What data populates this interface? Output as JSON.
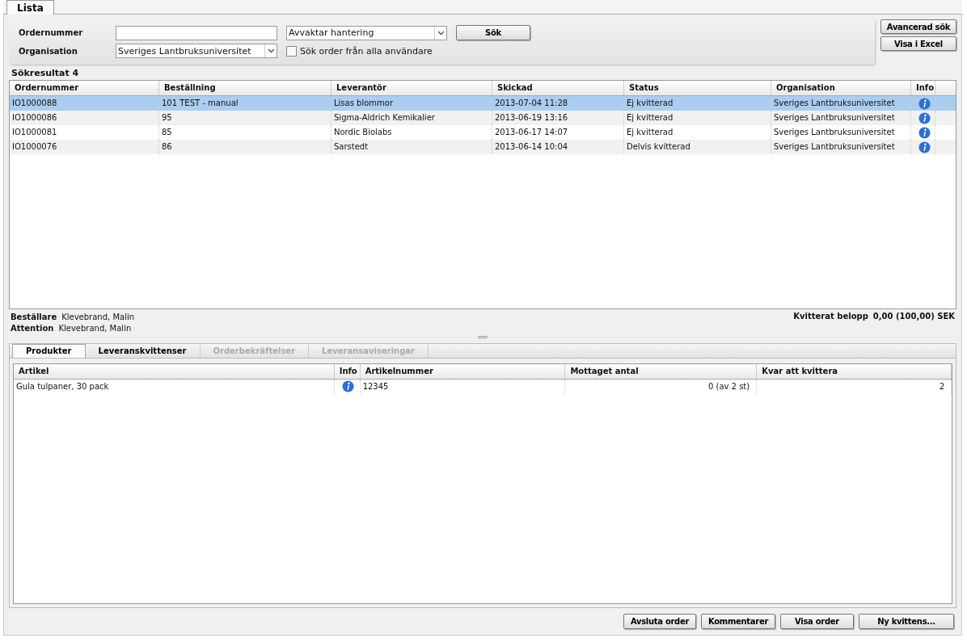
{
  "tabs": [
    {
      "label": "Lista",
      "selected": true
    }
  ],
  "search": {
    "order_label": "Ordernummer",
    "org_label": "Organisation",
    "org_value": "Sveriges Lantbruksuniversitet",
    "status_value": "Avvaktar hantering",
    "all_users": {
      "label": "Sök order från alla användare",
      "checked": false
    },
    "search_button": "Sök"
  },
  "side_buttons": [
    "Avancerad sök",
    "Visa i Excel"
  ],
  "results": {
    "title": "Sökresultat 4",
    "columns": [
      "Ordernummer",
      "Beställning",
      "Leverantör",
      "Skickad",
      "Status",
      "Organisation",
      "Info"
    ],
    "rows": [
      {
        "selected": true,
        "cells": [
          "IO1000088",
          "101 TEST - manual",
          "Lisas blommor",
          "2013-07-04 11:28",
          "Ej kvitterad",
          "Sveriges Lantbruksuniversitet"
        ]
      },
      {
        "selected": false,
        "cells": [
          "IO1000086",
          "95",
          "Sigma-Aldrich Kemikalier",
          "2013-06-19 13:16",
          "Ej kvitterad",
          "Sveriges Lantbruksuniversitet"
        ]
      },
      {
        "selected": false,
        "cells": [
          "IO1000081",
          "85",
          "Nordic Biolabs",
          "2013-06-17 14:07",
          "Ej kvitterad",
          "Sveriges Lantbruksuniversitet"
        ]
      },
      {
        "selected": false,
        "cells": [
          "IO1000076",
          "86",
          "Sarstedt",
          "2013-06-14 10:04",
          "Delvis kvitterad",
          "Sveriges Lantbruksuniversitet"
        ]
      }
    ]
  },
  "details": [
    {
      "label": "Beställare",
      "value": "Klevebrand, Malin"
    },
    {
      "label": "Attention",
      "value": "Klevebrand, Malin"
    }
  ],
  "amount": {
    "label": "Kvitterat belopp",
    "value": "0,00 (100,00) SEK"
  },
  "detail_tabs": [
    {
      "label": "Produkter",
      "selected": true,
      "disabled": false
    },
    {
      "label": "Leveranskvittenser",
      "selected": false,
      "disabled": false
    },
    {
      "label": "Orderbekräftelser",
      "selected": false,
      "disabled": true
    },
    {
      "label": "Leveransaviseringar",
      "selected": false,
      "disabled": true
    }
  ],
  "products": {
    "columns": [
      "Artikel",
      "Info",
      "Artikelnummer",
      "Mottaget antal",
      "Kvar att kvittera"
    ],
    "rows": [
      {
        "cells": [
          "Gula tulpaner, 30 pack",
          "",
          "12345",
          "0 (av 2 st)",
          "2"
        ]
      }
    ]
  },
  "footer_buttons": [
    "Avsluta order",
    "Kommentarer",
    "Visa order",
    "Ny kvittens..."
  ]
}
